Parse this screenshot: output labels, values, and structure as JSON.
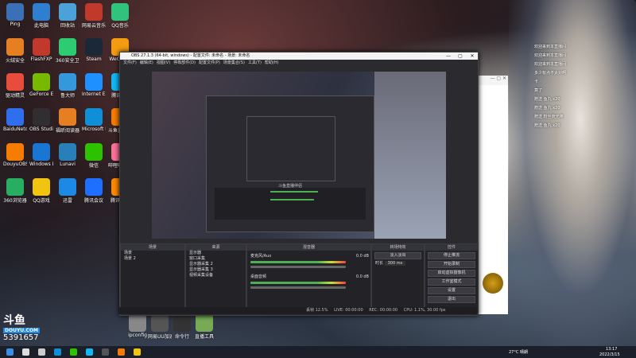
{
  "desktop": {
    "icons": [
      {
        "label": "Ping",
        "color": "#3b6fb6"
      },
      {
        "label": "此电脑",
        "color": "#2f7fd0"
      },
      {
        "label": "回收站",
        "color": "#4aa2d8"
      },
      {
        "label": "网易云音乐",
        "color": "#c0392b"
      },
      {
        "label": "QQ音乐",
        "color": "#31c27c"
      },
      {
        "label": "火绒安全",
        "color": "#e67e22"
      },
      {
        "label": "FlashFXP",
        "color": "#c0392b"
      },
      {
        "label": "360安全卫士",
        "color": "#2ecc71"
      },
      {
        "label": "Steam",
        "color": "#1b2838"
      },
      {
        "label": "WeGame",
        "color": "#f39c12"
      },
      {
        "label": "驱动精灵",
        "color": "#e74c3c"
      },
      {
        "label": "GeForce Experience",
        "color": "#76b900"
      },
      {
        "label": "鲁大师",
        "color": "#3498db"
      },
      {
        "label": "Internet Explorer",
        "color": "#1e90ff"
      },
      {
        "label": "腾讯QQ",
        "color": "#12b7f5"
      },
      {
        "label": "BaiduNetdisk",
        "color": "#2f6fed"
      },
      {
        "label": "OBS Studio",
        "color": "#302e31"
      },
      {
        "label": "福昕阅读器",
        "color": "#e67e22"
      },
      {
        "label": "Microsoft Edge",
        "color": "#0f8fd8"
      },
      {
        "label": "斗鱼直播伴侣",
        "color": "#f57c00"
      },
      {
        "label": "DouyuOBS",
        "color": "#f57c00"
      },
      {
        "label": "Windows Media",
        "color": "#1976d2"
      },
      {
        "label": "Lunavi",
        "color": "#2980b9"
      },
      {
        "label": "微信",
        "color": "#2dc100"
      },
      {
        "label": "哔哩哔哩直播姬",
        "color": "#fb7299"
      },
      {
        "label": "360浏览器",
        "color": "#27ae60"
      },
      {
        "label": "QQ游戏",
        "color": "#f1c40f"
      },
      {
        "label": "迅雷",
        "color": "#1e88e5"
      },
      {
        "label": "腾讯会议",
        "color": "#1e6fff"
      },
      {
        "label": "腾讯视频",
        "color": "#ff8800"
      }
    ],
    "right_icons": [
      {
        "label": "ipconfig",
        "color": "#888"
      },
      {
        "label": "网易UU加速器",
        "color": "#555"
      },
      {
        "label": "命令行",
        "color": "#333"
      },
      {
        "label": "直播工具",
        "color": "#7a5"
      }
    ]
  },
  "douyu_logo": {
    "brand": "斗鱼",
    "url": "DOUYU.COM",
    "room": "5391657"
  },
  "obs": {
    "title": "OBS 27.1.3 (64-bit, windows) - 配置文件: 未命名 - 场景: 未命名",
    "menu": [
      "文件(F)",
      "编辑(E)",
      "视图(V)",
      "停靠部件(D)",
      "配置文件(P)",
      "场景集合(S)",
      "工具(T)",
      "帮助(H)"
    ],
    "docks": {
      "scenes": {
        "header": "场景",
        "items": [
          "场景",
          "场景 2"
        ]
      },
      "sources": {
        "header": "来源",
        "items": [
          "显示器",
          "窗口采集",
          "显示器采集 2",
          "显示器采集 3",
          "视频采集设备"
        ]
      },
      "mixer": {
        "header": "混音器",
        "channels": [
          {
            "name": "麦克风/Aux",
            "level": "0.0 dB"
          },
          {
            "name": "桌面音频",
            "level": "0.0 dB"
          }
        ]
      },
      "transitions": {
        "header": "转场特效",
        "type": "淡入淡出",
        "duration_label": "时长",
        "duration": "300 ms"
      },
      "controls": {
        "header": "控件",
        "buttons": [
          "停止推流",
          "开始录制",
          "启动虚拟摄像机",
          "工作室模式",
          "设置",
          "退出"
        ]
      }
    },
    "status": {
      "live": "LIVE: 00:00:00",
      "rec": "REC: 00:00:00",
      "cpu": "CPU: 1.1%, 30.00 fps",
      "drop": "丢帧 12.5%"
    },
    "nested_title": "斗鱼直播伴侣"
  },
  "chat": {
    "messages": [
      "欢迎来到本直播间",
      "欢迎来到本直播间",
      "欢迎来到本直播间",
      "多少有点不太对啊",
      "卡",
      "算了",
      "赠送 鱼丸 x20",
      "赠送 鱼丸 x20",
      "赠送 粉丝荧光棒",
      "赠送 鱼丸 x20"
    ]
  },
  "taskbar": {
    "weather": "27°C 晴朗",
    "time": "13:17",
    "date": "2022/3/15",
    "apps": [
      {
        "name": "start",
        "color": "#3a8ee6"
      },
      {
        "name": "search",
        "color": "#ddd"
      },
      {
        "name": "task-view",
        "color": "#ccc"
      },
      {
        "name": "edge",
        "color": "#0f8fd8"
      },
      {
        "name": "wechat",
        "color": "#2dc100"
      },
      {
        "name": "qq",
        "color": "#12b7f5"
      },
      {
        "name": "obs",
        "color": "#555"
      },
      {
        "name": "douyu",
        "color": "#f57c00"
      },
      {
        "name": "explorer",
        "color": "#f1c40f"
      }
    ]
  }
}
